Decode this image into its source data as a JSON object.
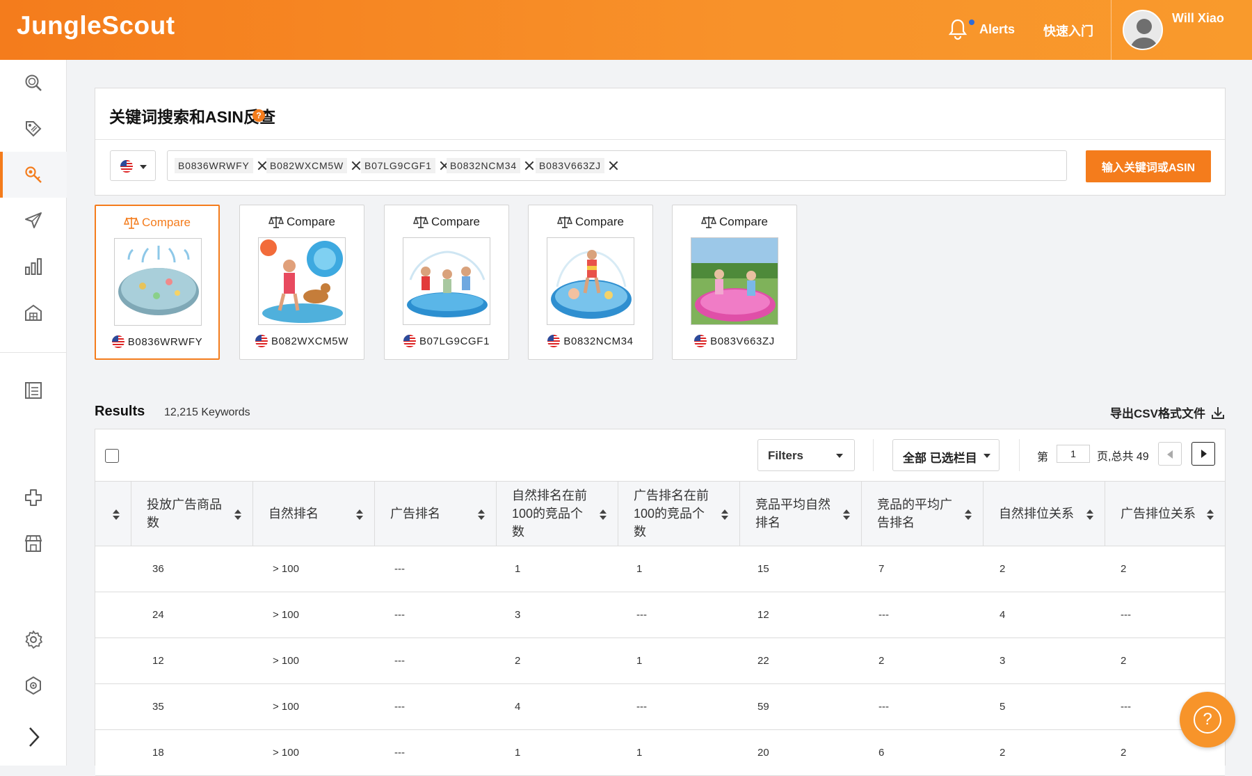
{
  "header": {
    "logo": "JungleScout",
    "alerts": "Alerts",
    "quick_start": "快速入门",
    "user": "Will Xiao"
  },
  "colors": {
    "brand": "#f47c1c",
    "alert_dot": "#2e6bd8"
  },
  "sidebar": {
    "items": [
      {
        "icon": "search-icon"
      },
      {
        "icon": "tag-icon"
      },
      {
        "icon": "key-search-icon",
        "active": true
      },
      {
        "icon": "rocket-icon"
      },
      {
        "icon": "bar-chart-icon"
      },
      {
        "icon": "warehouse-icon"
      },
      {
        "icon": "notebook-icon"
      },
      {
        "icon": "extension-icon"
      },
      {
        "icon": "store-icon"
      },
      {
        "icon": "settings-icon"
      },
      {
        "icon": "shield-gear-icon"
      },
      {
        "icon": "chevron-right-icon"
      }
    ]
  },
  "search": {
    "title": "关键词搜索和ASIN反查",
    "help_badge": "?",
    "country": "US",
    "tags": [
      "B0836WRWFY",
      "B082WXCM5W",
      "B07LG9CGF1",
      "B0832NCM34",
      "B083V663ZJ"
    ],
    "submit_label": "输入关键词或ASIN"
  },
  "products": [
    {
      "compare": "Compare",
      "asin": "B0836WRWFY",
      "selected": true
    },
    {
      "compare": "Compare",
      "asin": "B082WXCM5W",
      "selected": false
    },
    {
      "compare": "Compare",
      "asin": "B07LG9CGF1",
      "selected": false
    },
    {
      "compare": "Compare",
      "asin": "B0832NCM34",
      "selected": false
    },
    {
      "compare": "Compare",
      "asin": "B083V663ZJ",
      "selected": false
    }
  ],
  "results": {
    "title": "Results",
    "count": "12,215 Keywords",
    "export": "导出CSV格式文件",
    "filters": "Filters",
    "columns_btn": "全部 已选栏目",
    "page_prefix": "第",
    "page_value": "1",
    "page_suffix": "页,总共 49"
  },
  "table": {
    "headers": [
      "投放广告商品数",
      "自然排名",
      "广告排名",
      "自然排名在前100的竞品个数",
      "广告排名在前100的竞品个数",
      "竞品平均自然排名",
      "竞品的平均广告排名",
      "自然排位关系",
      "广告排位关系"
    ],
    "rows": [
      [
        "36",
        "> 100",
        "---",
        "1",
        "1",
        "15",
        "7",
        "2",
        "2"
      ],
      [
        "24",
        "> 100",
        "---",
        "3",
        "---",
        "12",
        "---",
        "4",
        "---"
      ],
      [
        "12",
        "> 100",
        "---",
        "2",
        "1",
        "22",
        "2",
        "3",
        "2"
      ],
      [
        "35",
        "> 100",
        "---",
        "4",
        "---",
        "59",
        "---",
        "5",
        "---"
      ],
      [
        "18",
        "> 100",
        "---",
        "1",
        "1",
        "20",
        "6",
        "2",
        "2"
      ]
    ]
  }
}
